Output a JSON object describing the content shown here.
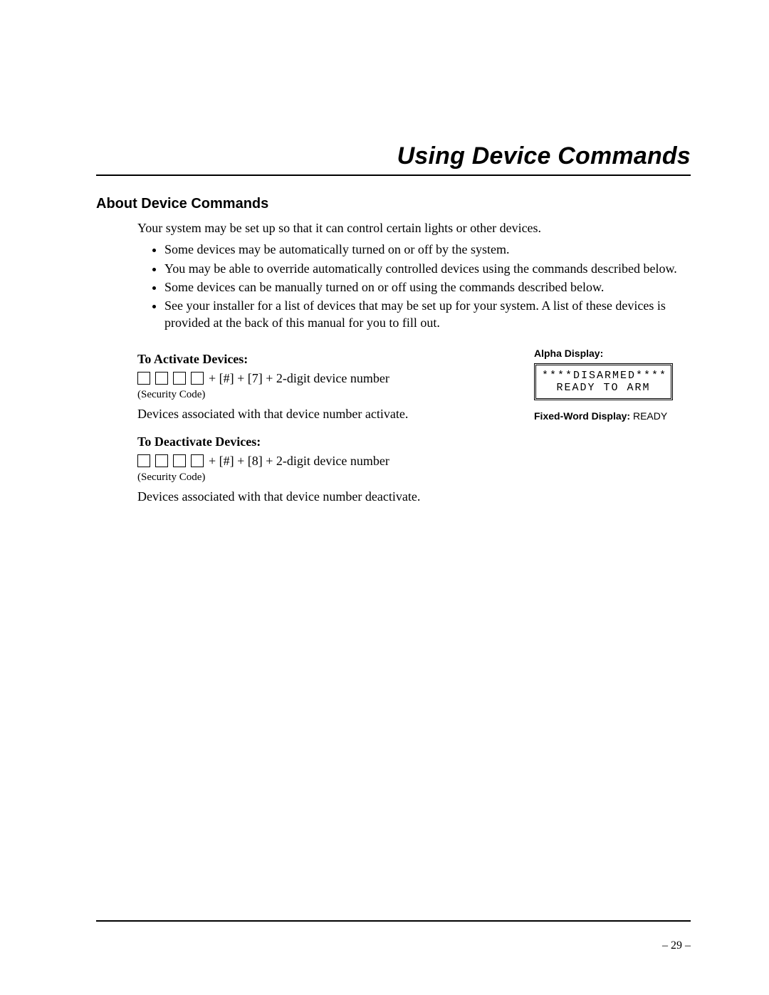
{
  "title": "Using Device Commands",
  "section_heading": "About Device Commands",
  "intro": "Your system may be set up so that it can control certain lights or other devices.",
  "bullets": [
    "Some devices may be automatically turned on or off by the system.",
    "You may be able to override automatically controlled devices using the commands described below.",
    "Some devices can be manually turned on or off using the commands described below.",
    "See your installer for a list of devices that may be set up for your system. A list of these devices is provided at the back of this manual for you to fill out."
  ],
  "activate": {
    "heading": "To Activate Devices:",
    "sequence_suffix": "+  [#] + [7] + 2-digit device number",
    "security_label": "(Security Code)",
    "result": "Devices associated with that device number activate."
  },
  "deactivate": {
    "heading": "To Deactivate Devices:",
    "sequence_suffix": "+  [#] + [8] + 2-digit device number",
    "security_label": "(Security Code)",
    "result": "Devices associated with that device number deactivate."
  },
  "display_panel": {
    "alpha_label": "Alpha Display:",
    "lcd_line1": "****DISARMED****",
    "lcd_line2": "READY TO ARM",
    "fixed_label": "Fixed-Word Display: ",
    "fixed_value": "READY"
  },
  "page_number": "– 29 –"
}
